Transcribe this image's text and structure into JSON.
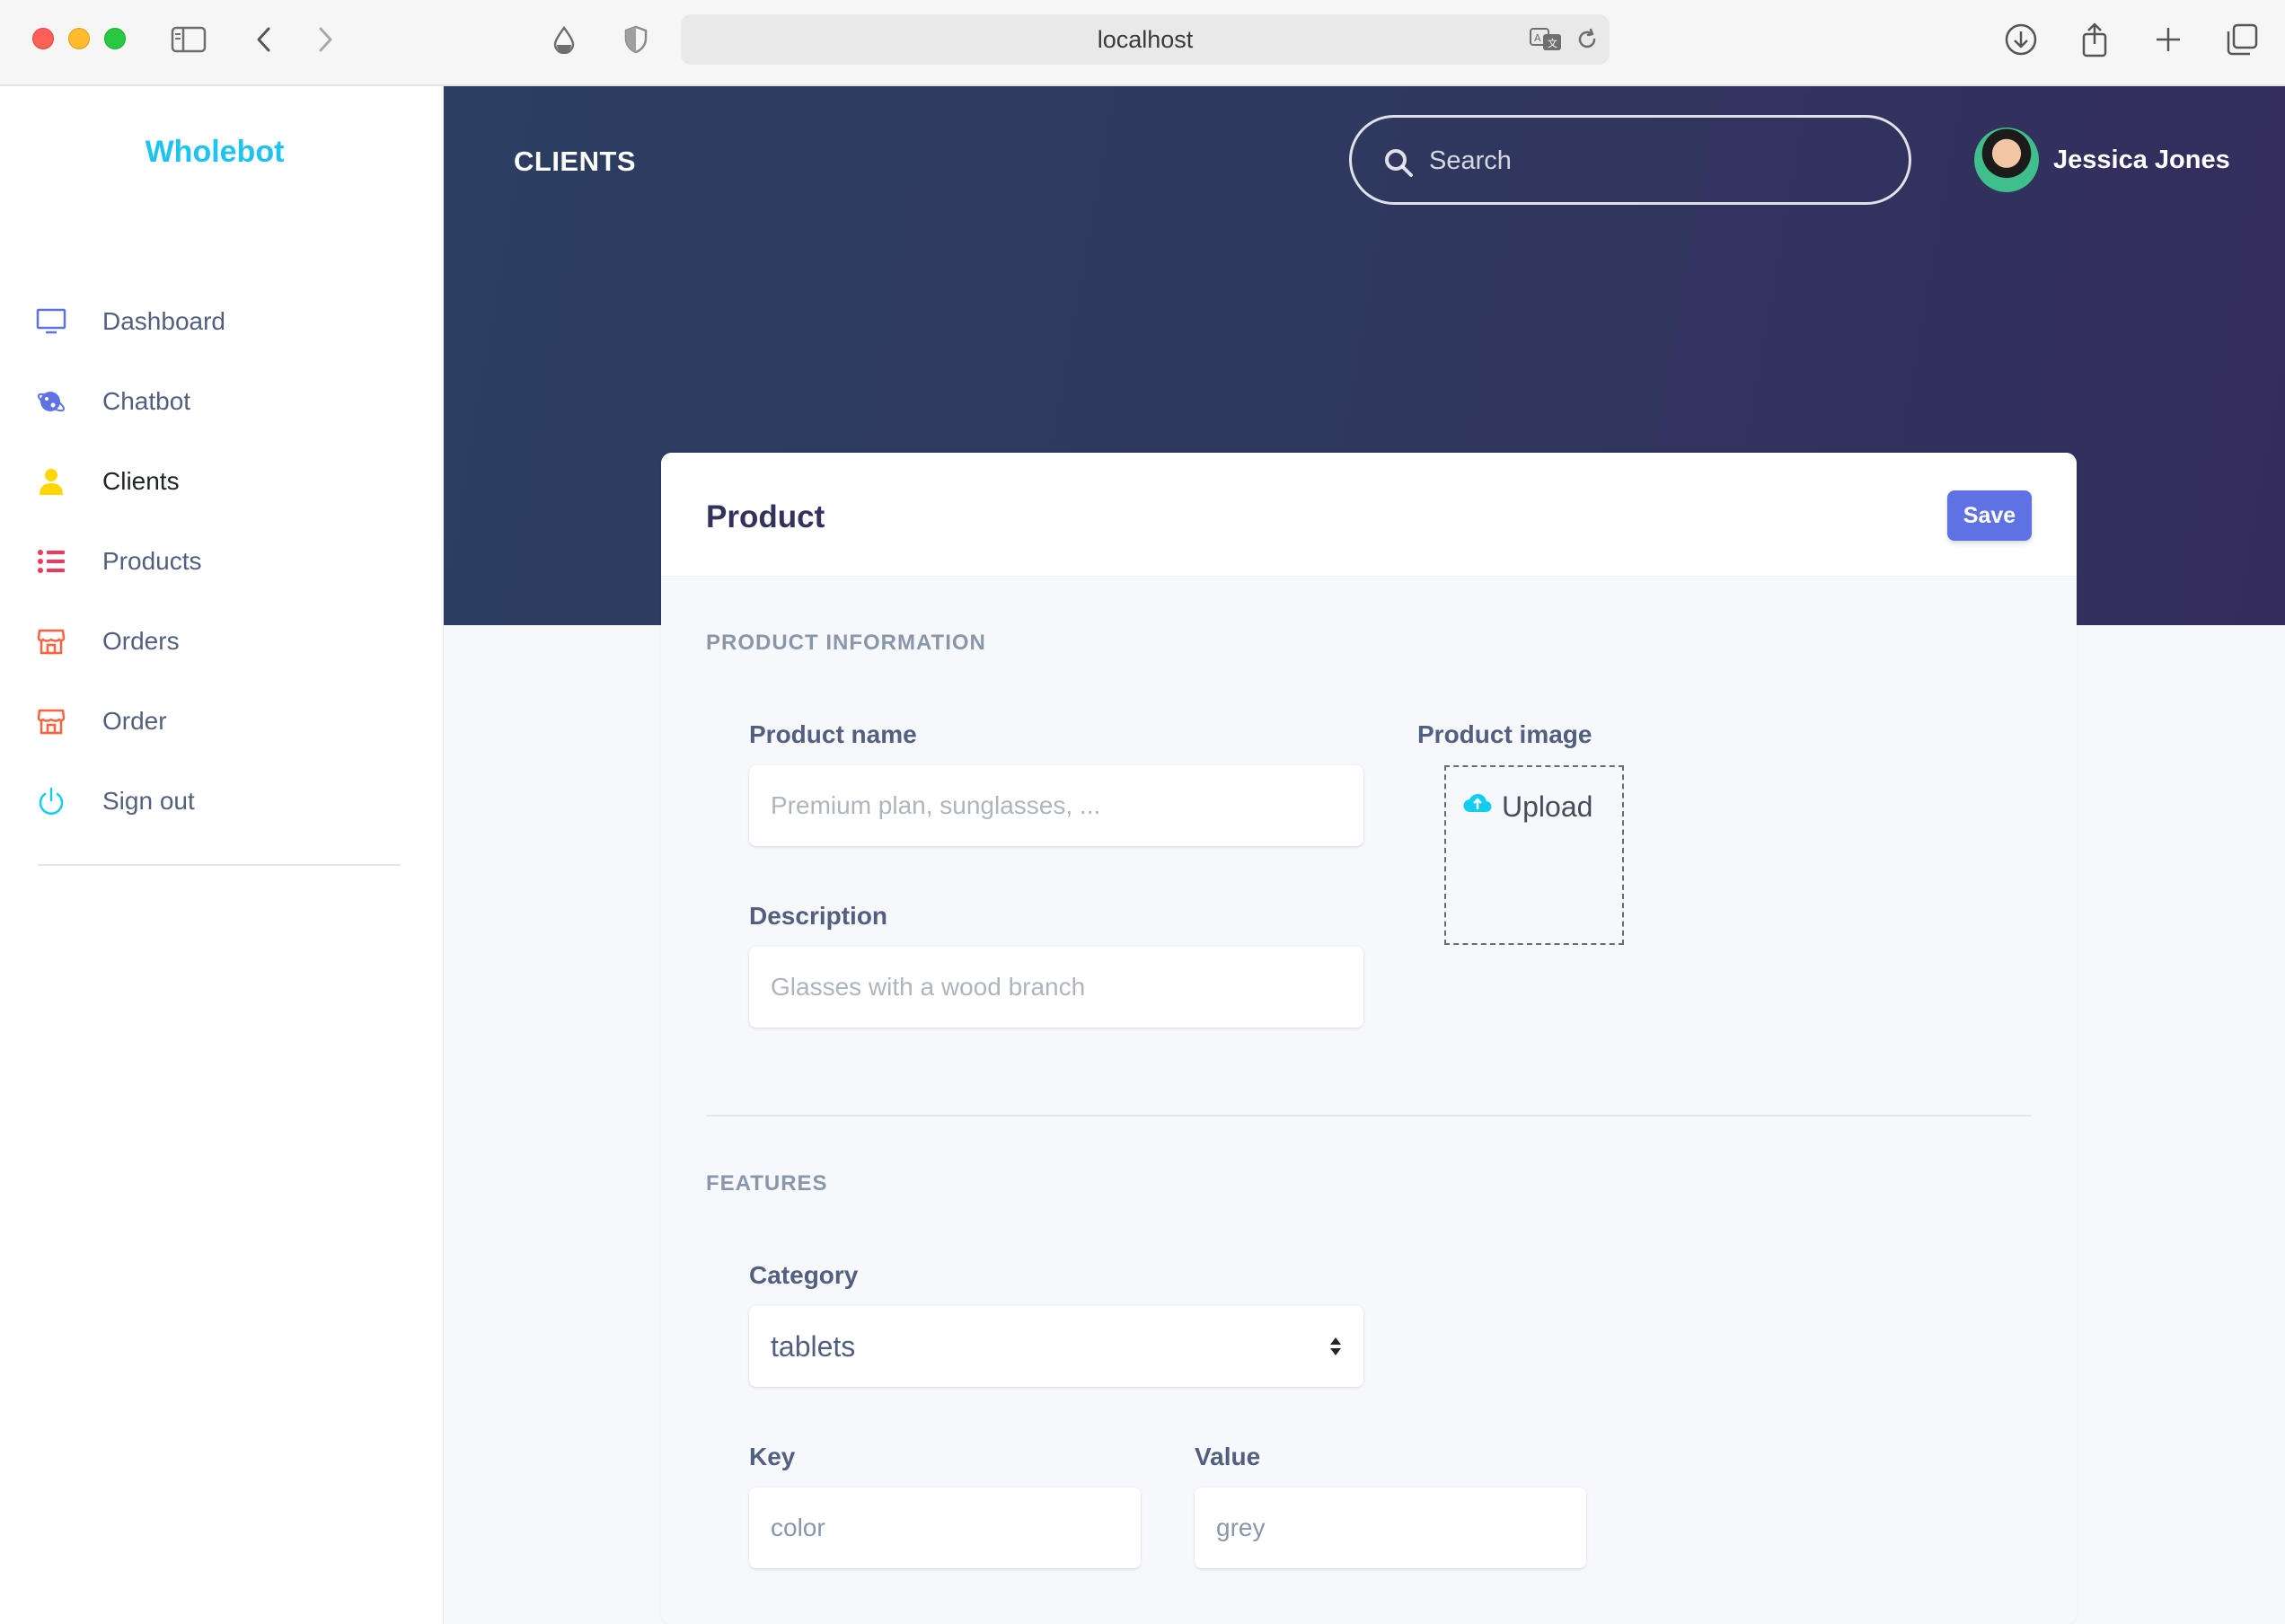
{
  "browser": {
    "address": "localhost"
  },
  "sidebar": {
    "brand": "Wholebot",
    "items": [
      {
        "label": "Dashboard",
        "icon": "monitor-icon",
        "color": "#5e72e4"
      },
      {
        "label": "Chatbot",
        "icon": "planet-icon",
        "color": "#5e72e4"
      },
      {
        "label": "Clients",
        "icon": "user-icon",
        "color": "#ffd600",
        "active": true
      },
      {
        "label": "Products",
        "icon": "list-icon",
        "color": "#f5365c"
      },
      {
        "label": "Orders",
        "icon": "shop-icon",
        "color": "#fb6340"
      },
      {
        "label": "Order",
        "icon": "shop-icon",
        "color": "#fb6340"
      },
      {
        "label": "Sign out",
        "icon": "power-icon",
        "color": "#11cdef"
      }
    ]
  },
  "header": {
    "title": "CLIENTS",
    "search_placeholder": "Search",
    "user_name": "Jessica Jones"
  },
  "card": {
    "title": "Product",
    "save_label": "Save",
    "product_info_heading": "PRODUCT INFORMATION",
    "product_name_label": "Product name",
    "product_name_placeholder": "Premium plan, sunglasses, ...",
    "description_label": "Description",
    "description_placeholder": "Glasses with a wood branch",
    "product_image_label": "Product image",
    "upload_label": "Upload",
    "features_heading": "FEATURES",
    "category_label": "Category",
    "category_value": "tablets",
    "key_label": "Key",
    "key_value": "color",
    "value_label": "Value",
    "value_value": "grey"
  },
  "colors": {
    "brand": "#1ec3f0",
    "primary": "#5e72e4",
    "hero_dark": "#2c3e62"
  }
}
